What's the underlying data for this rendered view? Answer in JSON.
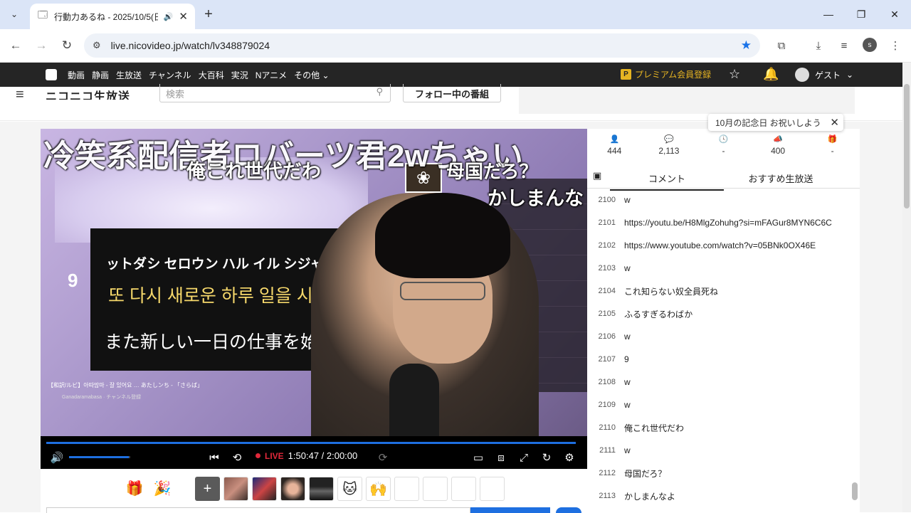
{
  "browser": {
    "tab_title": "行動力あるね - 2025/10/5(日",
    "url": "live.nicovideo.jp/watch/lv348879024",
    "profile_initial": "s"
  },
  "nicobar": {
    "nav": [
      "動画",
      "静画",
      "生放送",
      "チャンネル",
      "大百科",
      "実況",
      "Nアニメ",
      "その他"
    ],
    "premium_label": "プレミアム会員登録",
    "guest_label": "ゲスト"
  },
  "header": {
    "site_logo": "ニコニコ生放送",
    "search_placeholder": "検索",
    "follow_button": "フォロー中の番組"
  },
  "notice": {
    "text": "10月の記念日 お祝いしよう"
  },
  "player": {
    "danmaku": [
      "冷笑系配信者ロバーツ君2wちゃい",
      "俺これ世代だわ",
      "母国だろ？",
      "かしまんな"
    ],
    "video_text": {
      "line1": "ットダシ セロウン ハル イル シジャ",
      "line2": "또 다시 새로운 하루 일을 시",
      "line3": "また新しい一日の仕事を始",
      "number": "9",
      "yt_title": "【和訳/ルビ】아따맘마 - 잘 있어요 … あたしンち - 「さらば」",
      "yt_channel": "Ganadaramabasa",
      "yt_subscribe": "チャンネル登録"
    },
    "live_label": "LIVE",
    "time": "1:50:47 / 2:00:00",
    "volume_level": 0.98,
    "progress": 0.99
  },
  "stats": [
    {
      "icon": "viewer-icon",
      "value": "444"
    },
    {
      "icon": "comment-count-icon",
      "value": "2,113"
    },
    {
      "icon": "clock-icon",
      "value": "-"
    },
    {
      "icon": "ad-icon",
      "value": "400"
    },
    {
      "icon": "gift-icon",
      "value": "-"
    }
  ],
  "panel_tabs": {
    "comment": "コメント",
    "recommend": "おすすめ生放送"
  },
  "comments": [
    {
      "no": "2100",
      "text": "w"
    },
    {
      "no": "2101",
      "text": "https://youtu.be/H8MlgZohuhg?si=mFAGur8MYN6C6C"
    },
    {
      "no": "2102",
      "text": "https://www.youtube.com/watch?v=05BNk0OX46E"
    },
    {
      "no": "2103",
      "text": "w"
    },
    {
      "no": "2104",
      "text": "これ知らない奴全員死ね"
    },
    {
      "no": "2105",
      "text": "ふるすぎるわばか"
    },
    {
      "no": "2106",
      "text": "w"
    },
    {
      "no": "2107",
      "text": "9"
    },
    {
      "no": "2108",
      "text": "w"
    },
    {
      "no": "2109",
      "text": "w"
    },
    {
      "no": "2110",
      "text": "俺これ世代だわ"
    },
    {
      "no": "2111",
      "text": "w"
    },
    {
      "no": "2112",
      "text": "母国だろ？"
    },
    {
      "no": "2113",
      "text": "かしまんなよ"
    }
  ]
}
